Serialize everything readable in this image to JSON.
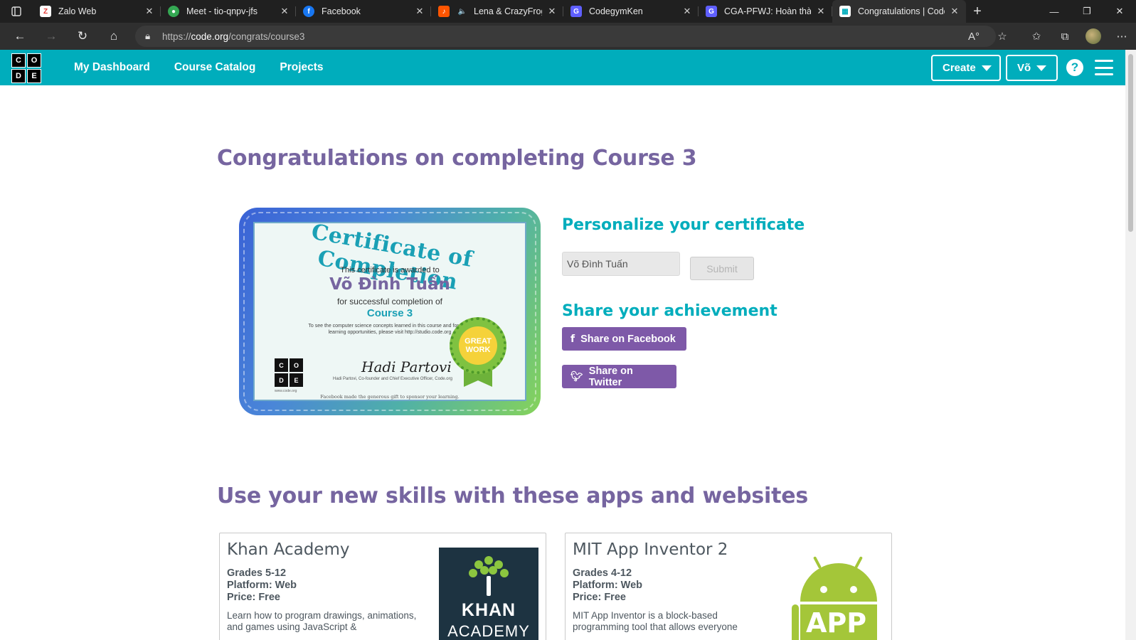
{
  "browser": {
    "tabs": [
      {
        "label": "Zalo Web",
        "favicon_color": "#ffffff",
        "favicon_text": "Z",
        "favicon_fg": "#e53935",
        "active": false
      },
      {
        "label": "Meet - tio-qnpv-jfs",
        "favicon_color": "#34a853",
        "favicon_text": "●",
        "favicon_fg": "#ffffff",
        "active": false
      },
      {
        "label": "Facebook",
        "favicon_color": "#1877f2",
        "favicon_text": "f",
        "favicon_fg": "#ffffff",
        "active": false
      },
      {
        "label": "Lena & CrazyFrog",
        "favicon_color": "#ff5500",
        "favicon_text": "♪",
        "favicon_fg": "#ffffff",
        "active": false
      },
      {
        "label": "CodegymKen",
        "favicon_color": "#5f5fff",
        "favicon_text": "G",
        "favicon_fg": "#ffffff",
        "active": false
      },
      {
        "label": "CGA-PFWJ: Hoàn thành",
        "favicon_color": "#5f5fff",
        "favicon_text": "G",
        "favicon_fg": "#ffffff",
        "active": false
      },
      {
        "label": "Congratulations | Code.",
        "favicon_color": "#ffffff",
        "favicon_text": "▦",
        "favicon_fg": "#00adbc",
        "active": true
      }
    ],
    "url_prefix": "https://",
    "url_host": "code.org",
    "url_path": "/congrats/course3",
    "icons": {
      "back": "back-arrow-icon",
      "forward": "forward-arrow-icon",
      "refresh": "refresh-icon",
      "home": "home-icon",
      "lock": "lock-icon",
      "read_aloud": "read-aloud-icon",
      "favorite": "add-favorite-icon",
      "favorites": "favorites-icon",
      "collections": "collections-icon",
      "profile": "profile-avatar",
      "menu": "more-menu-icon"
    }
  },
  "site": {
    "brand_color": "#00adbc",
    "accent_purple": "#7665a0",
    "logo_letters": [
      "C",
      "O",
      "D",
      "E"
    ],
    "nav": [
      "My Dashboard",
      "Course Catalog",
      "Projects"
    ],
    "create_label": "Create",
    "user_label": "Võ",
    "help_label": "?"
  },
  "main": {
    "title": "Congratulations on completing Course 3",
    "certificate": {
      "title": "Certificate of Completion",
      "awarded": "This certificate is awarded to",
      "name": "Võ Đình Tuấn",
      "for": "for successful completion of",
      "course": "Course 3",
      "note": "To see the computer science concepts learned in this course and for more learning opportunities, please visit http://studio.code.org",
      "signature": "Hadi Partovi",
      "signer": "Hadi Partovi, Co-founder and Chief Executive Officer, Code.org",
      "footer": "Facebook made the generous gift to sponsor your learning.",
      "badge": "GREAT WORK",
      "logo_url": "www.code.org"
    },
    "personalize_title": "Personalize your certificate",
    "name_value": "Võ Đình Tuấn",
    "submit_label": "Submit",
    "share_title": "Share your achievement",
    "share_facebook": "Share on Facebook",
    "share_twitter": "Share on Twitter",
    "apps_title": "Use your new skills with these apps and websites",
    "apps": [
      {
        "name": "Khan Academy",
        "grades": "Grades 5-12",
        "platform": "Platform: Web",
        "price": "Price: Free",
        "desc": "Learn how to program drawings, animations, and games using JavaScript &",
        "image_text_1": "KHAN",
        "image_text_2": "ACADEMY"
      },
      {
        "name": "MIT App Inventor 2",
        "grades": "Grades 4-12",
        "platform": "Platform: Web",
        "price": "Price: Free",
        "desc": "MIT App Inventor is a block-based programming tool that allows everyone",
        "image_text": "APP"
      }
    ]
  }
}
